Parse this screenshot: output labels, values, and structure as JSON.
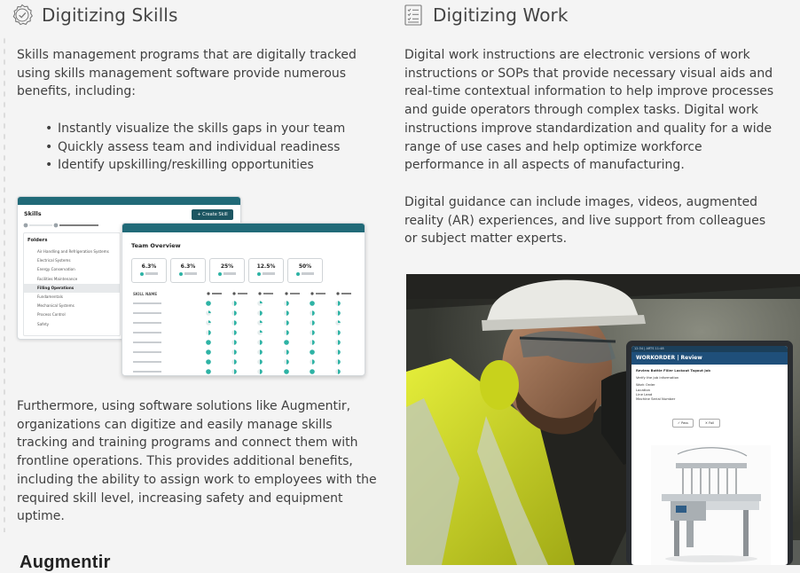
{
  "left": {
    "title": "Digitizing Skills",
    "intro": "Skills management programs that are digitally tracked using skills management software provide numerous benefits, including:",
    "bullets": [
      "Instantly visualize the skills gaps in your team",
      "Quickly assess team and individual readiness",
      "Identify upskilling/reskilling opportunities"
    ],
    "outro": "Furthermore, using software solutions like Augmentir, organizations can digitize and easily manage skills tracking and training programs and connect them with frontline operations. This provides additional benefits, including the ability to assign work to employees with the required skill level, increasing safety and equipment uptime.",
    "logo_text": "Augmentir"
  },
  "right": {
    "title": "Digitizing Work",
    "para1": "Digital work instructions are electronic versions of work instructions or SOPs that provide necessary visual aids and real-time contextual information to help improve processes and guide operators through complex tasks. Digital work instructions improve standardization and quality for a wide range of use cases and help optimize workforce performance in all aspects of manufacturing.",
    "para2": "Digital guidance can include images, videos, augmented reality (AR) experiences, and live support from colleagues or subject matter experts."
  },
  "skills_mock": {
    "title": "Skills",
    "create_button": "+ Create Skill",
    "folders_heading": "Folders",
    "folders": [
      "Air Handling and Refrigeration Systems",
      "Electrical Systems",
      "Energy Conservation",
      "Facilities Maintenance",
      "Filling Operations",
      "Fundamentals",
      "Mechanical Systems",
      "Process Control",
      "Safety"
    ],
    "selected_folder": "Filling Operations",
    "team_title": "Team Overview",
    "stats": [
      {
        "pct": "6.3%"
      },
      {
        "pct": "6.3%"
      },
      {
        "pct": "25%"
      },
      {
        "pct": "12.5%"
      },
      {
        "pct": "50%"
      }
    ],
    "matrix_header": "SKILL NAME",
    "matrix_levels": [
      [
        1,
        0.5,
        0.25,
        0.5,
        1,
        0.5
      ],
      [
        0.25,
        0.5,
        0.5,
        0.5,
        0.5,
        0.5
      ],
      [
        0.25,
        0.5,
        0.25,
        0.5,
        0.5,
        0.25
      ],
      [
        0.5,
        0.5,
        0.25,
        0.5,
        0.5,
        0.5
      ],
      [
        1,
        0.5,
        0.5,
        1,
        0.5,
        0.5
      ],
      [
        1,
        0.5,
        0.5,
        0.5,
        1,
        0.5
      ],
      [
        1,
        0.5,
        0.5,
        0.5,
        0.5,
        0.5
      ],
      [
        1,
        0.5,
        0.5,
        1,
        1,
        0.5
      ]
    ]
  },
  "workorder": {
    "status_bar": "12:34 | ARTS 11:48",
    "header": "WORKORDER | Review",
    "step_title": "Review Bottle Filler Lockout Tagout Job",
    "subtitle": "Verify the job information",
    "fields": [
      "Work Order",
      "Location",
      "Line Lead",
      "Machine Serial Number"
    ],
    "pass_label": "✓ Pass",
    "fail_label": "✕ Fail"
  },
  "colors": {
    "teal_bar": "#216a78",
    "accent_teal": "#2eb3a5",
    "tablet_header": "#1f4f7a",
    "vest_yellow": "#d8e31f"
  }
}
